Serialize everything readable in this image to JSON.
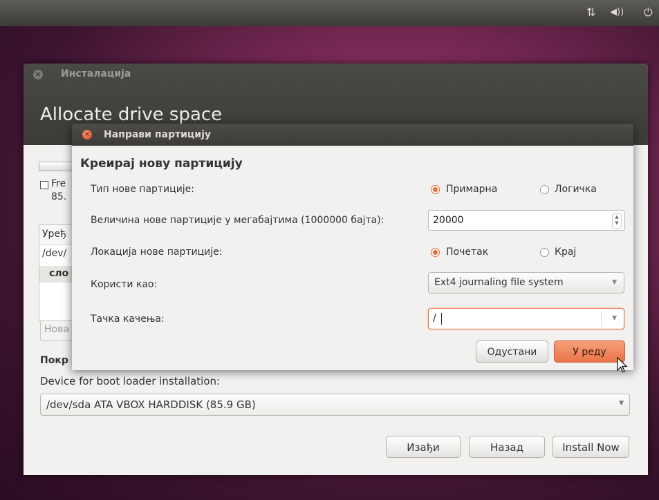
{
  "panel": {
    "icons": [
      "network-icon",
      "volume-icon",
      "power-icon"
    ]
  },
  "installer": {
    "title": "Инсталација",
    "heading": "Allocate drive space",
    "fragments": {
      "free": "Fre",
      "size": "85.",
      "device_col": "Уређ",
      "dev": "/dev/",
      "slo": "сло",
      "new_btn": "Нова",
      "boot_prefix": "Покр"
    },
    "boot_label": "Device for boot loader installation:",
    "boot_device": "/dev/sda ATA VBOX HARDDISK (85.9 GB)",
    "buttons": {
      "quit": "Изађи",
      "back": "Назад",
      "install": "Install Now"
    }
  },
  "dialog": {
    "title": "Направи партицију",
    "heading": "Креирај нову партицију",
    "type_label": "Тип нове партиције:",
    "type_primary": "Примарна",
    "type_logical": "Логичка",
    "type_selected": "primary",
    "size_label": "Величина нове партиције у мегабајтима (1000000 бајта):",
    "size_value": "20000",
    "location_label": "Локација нове партиције:",
    "location_begin": "Почетак",
    "location_end": "Крај",
    "location_selected": "begin",
    "use_as_label": "Користи као:",
    "use_as_value": "Ext4 journaling file system",
    "mount_label": "Тачка качења:",
    "mount_value": "/",
    "cancel": "Одустани",
    "ok": "У реду"
  },
  "colors": {
    "accent": "#e8713f",
    "titlebar": "#3c3b37"
  }
}
